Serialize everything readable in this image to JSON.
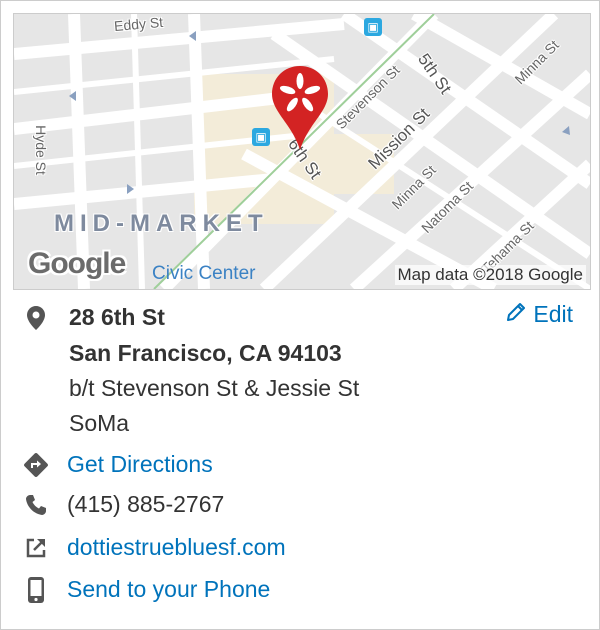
{
  "map": {
    "attribution": "Map data ©2018 Google",
    "logo": "Google",
    "neighborhood_label": "MID-MARKET",
    "civic_center_label": "Civic Center",
    "streets": {
      "eddy": "Eddy St",
      "hyde": "Hyde St",
      "stevenson": "Stevenson St",
      "fifth": "5th St",
      "sixth": "6th St",
      "mission": "Mission St",
      "minna_top": "Minna St",
      "minna": "Minna St",
      "natoma": "Natoma St",
      "tehama": "Tehama St"
    },
    "pin_icon": "yelp-burst-icon",
    "transit_icon": "tram-icon"
  },
  "address": {
    "street": "28 6th St",
    "city_line": "San Francisco, CA 94103",
    "cross_streets": "b/t Stevenson St & Jessie St",
    "neighborhood": "SoMa"
  },
  "edit_label": "Edit",
  "actions": {
    "directions": "Get Directions",
    "phone": "(415) 885-2767",
    "website": "dottiestruebluesf.com",
    "send_to_phone": "Send to your Phone"
  },
  "colors": {
    "link": "#0073bb",
    "yelp_red": "#d32323",
    "icon_gray": "#555555"
  }
}
